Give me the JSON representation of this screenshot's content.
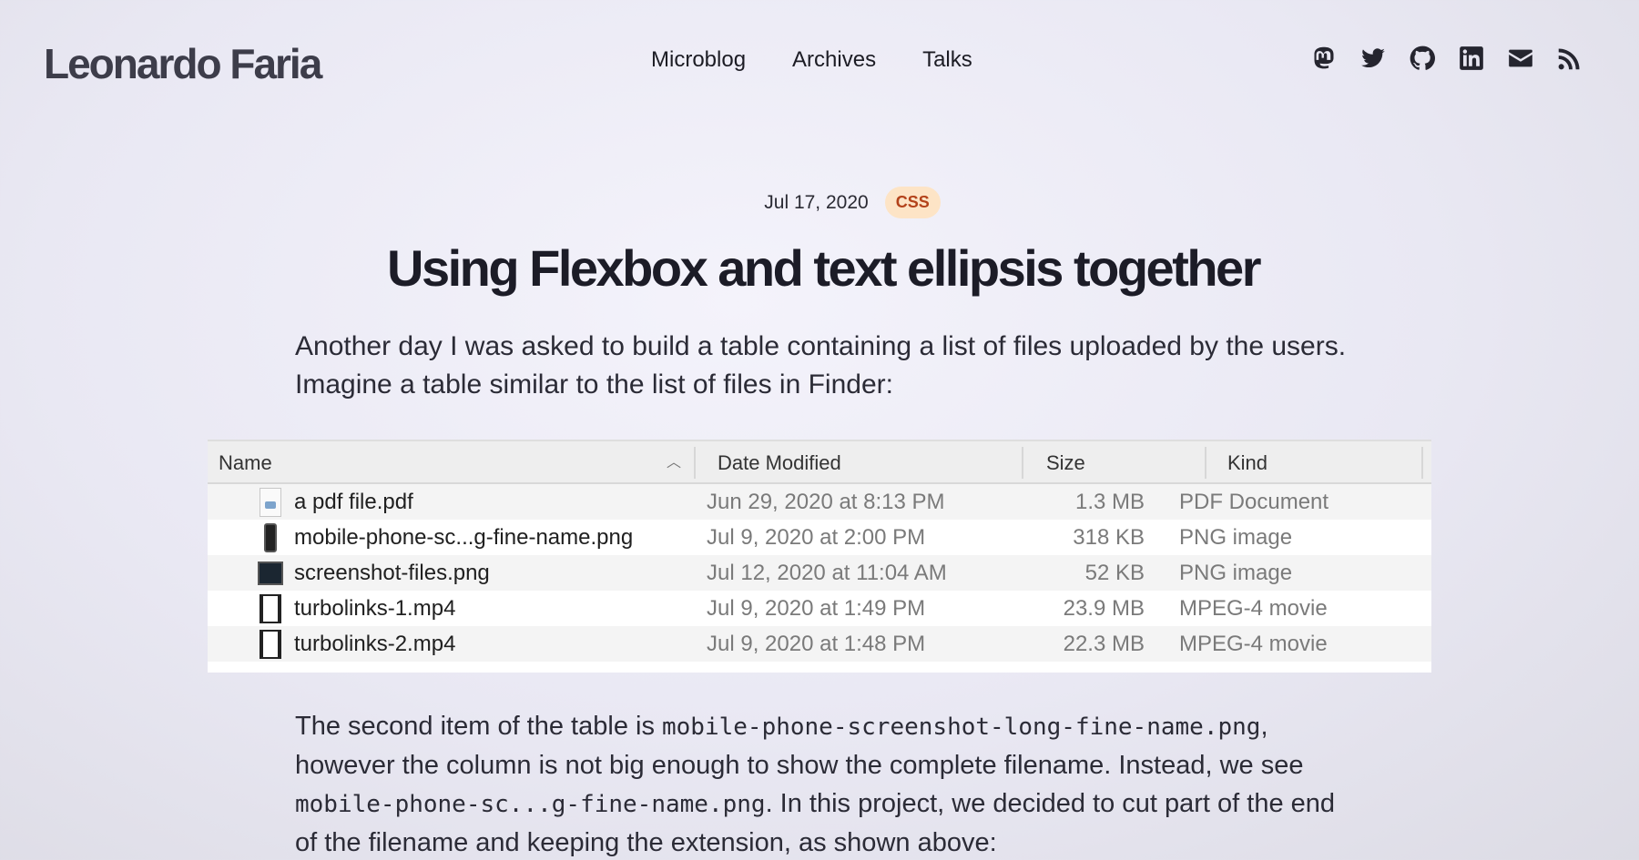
{
  "site": {
    "logo": "Leonardo Faria",
    "nav": [
      "Microblog",
      "Archives",
      "Talks"
    ],
    "social_icons": [
      "mastodon-icon",
      "twitter-icon",
      "github-icon",
      "linkedin-icon",
      "mail-icon",
      "rss-icon"
    ]
  },
  "post": {
    "date": "Jul 17, 2020",
    "tag": "CSS",
    "title": "Using Flexbox and text ellipsis together",
    "intro": "Another day I was asked to build a table containing a list of files uploaded by the users. Imagine a table similar to the list of files in Finder:",
    "p2_a": "The second item of the table is ",
    "p2_code1": "mobile-phone-screenshot-long-fine-name.png",
    "p2_b": ", however the column is not big enough to show the complete filename. Instead, we see ",
    "p2_code2": "mobile-phone-sc...g-fine-name.png",
    "p2_c": ". In this project, we decided to cut part of the end of the filename and keeping the extension, as shown above:"
  },
  "finder": {
    "columns": [
      "Name",
      "Date Modified",
      "Size",
      "Kind"
    ],
    "rows": [
      {
        "name": "a pdf file.pdf",
        "date": "Jun 29, 2020 at 8:13 PM",
        "size": "1.3 MB",
        "kind": "PDF Document",
        "icon": "pdf-file-icon"
      },
      {
        "name": "mobile-phone-sc...g-fine-name.png",
        "date": "Jul 9, 2020 at 2:00 PM",
        "size": "318 KB",
        "kind": "PNG image",
        "icon": "phone-image-icon"
      },
      {
        "name": "screenshot-files.png",
        "date": "Jul 12, 2020 at 11:04 AM",
        "size": "52 KB",
        "kind": "PNG image",
        "icon": "screenshot-image-icon"
      },
      {
        "name": "turbolinks-1.mp4",
        "date": "Jul 9, 2020 at 1:49 PM",
        "size": "23.9 MB",
        "kind": "MPEG-4 movie",
        "icon": "movie-file-icon"
      },
      {
        "name": "turbolinks-2.mp4",
        "date": "Jul 9, 2020 at 1:48 PM",
        "size": "22.3 MB",
        "kind": "MPEG-4 movie",
        "icon": "movie-file-icon"
      }
    ]
  }
}
